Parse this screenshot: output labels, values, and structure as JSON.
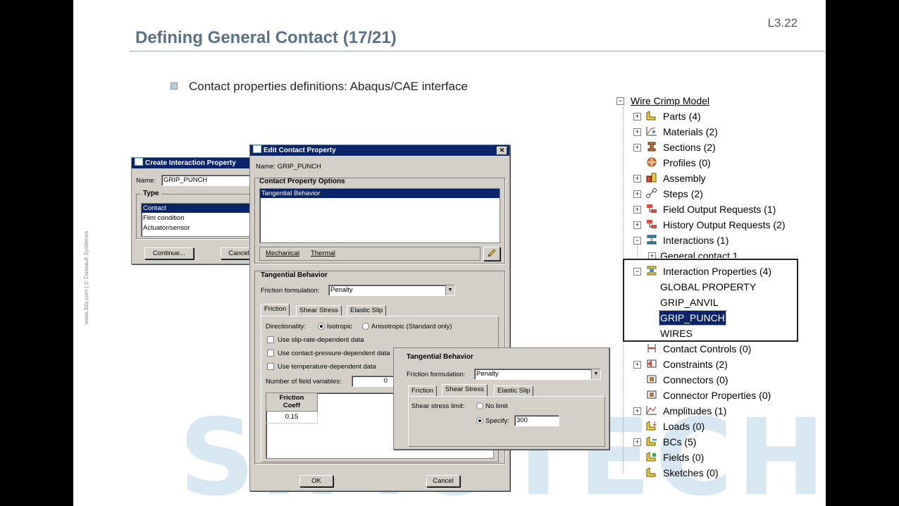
{
  "slide": {
    "number": "L3.22",
    "title": "Defining General Contact (17/21)",
    "bullet": "Contact properties definitions: Abaqus/CAE interface",
    "side_credit": "www.3ds.com | © Dassault Systèmes",
    "watermark": "SIMUTECH"
  },
  "create_dialog": {
    "title": "Create Interaction Property",
    "name_label": "Name:",
    "name_value": "GRIP_PUNCH",
    "type_label": "Type",
    "types": [
      "Contact",
      "Film condition",
      "Actuator/sensor"
    ],
    "continue_label": "Continue...",
    "cancel_label": "Cancel"
  },
  "edit_dialog": {
    "title": "Edit Contact Property",
    "close_glyph": "✕",
    "name_text": "Name:  GRIP_PUNCH",
    "options_title": "Contact Property Options",
    "options": [
      "Tangential Behavior"
    ],
    "menu_mechanical": "Mechanical",
    "menu_thermal": "Thermal",
    "behavior_title": "Tangential Behavior",
    "friction_label": "Friction formulation:",
    "friction_value": "Penalty",
    "tabs": [
      "Friction",
      "Shear Stress",
      "Elastic Slip"
    ],
    "directionality_label": "Directionality:",
    "isotropic_label": "Isotropic",
    "anisotropic_label": "Anisotropic (Standard only)",
    "checks": [
      "Use slip-rate-dependent data",
      "Use contact-pressure-dependent data",
      "Use temperature-dependent data"
    ],
    "field_vars_label": "Number of field variables:",
    "field_vars_value": "0",
    "table_header_line1": "Friction",
    "table_header_line2": "Coeff",
    "table_value": "0.15",
    "ok_label": "OK",
    "cancel_label": "Cancel"
  },
  "shear_panel": {
    "title": "Tangential Behavior",
    "friction_label": "Friction formulation:",
    "friction_value": "Penalty",
    "tabs": [
      "Friction",
      "Shear Stress",
      "Elastic Slip"
    ],
    "limit_label": "Shear stress limit:",
    "no_limit_label": "No limit",
    "specify_label": "Specify:",
    "specify_value": "300"
  },
  "tree": {
    "root": "Wire Crimp Model",
    "parts": "Parts (4)",
    "materials": "Materials (2)",
    "sections": "Sections (2)",
    "profiles": "Profiles (0)",
    "assembly": "Assembly",
    "steps": "Steps (2)",
    "field_output": "Field Output Requests (1)",
    "history_output": "History Output Requests (2)",
    "interactions": "Interactions (1)",
    "general_contact": "General contact 1",
    "interaction_properties": "Interaction Properties (4)",
    "prop_items": [
      "GLOBAL PROPERTY",
      "GRIP_ANVIL",
      "GRIP_PUNCH",
      "WIRES"
    ],
    "contact_controls": "Contact Controls (0)",
    "constraints": "Constraints (2)",
    "connectors": "Connectors (0)",
    "connector_properties": "Connector Properties (0)",
    "amplitudes": "Amplitudes (1)",
    "loads": "Loads (0)",
    "bcs": "BCs (5)",
    "fields": "Fields (0)",
    "sketches": "Sketches (0)",
    "expand_plus": "+",
    "expand_minus": "−"
  }
}
